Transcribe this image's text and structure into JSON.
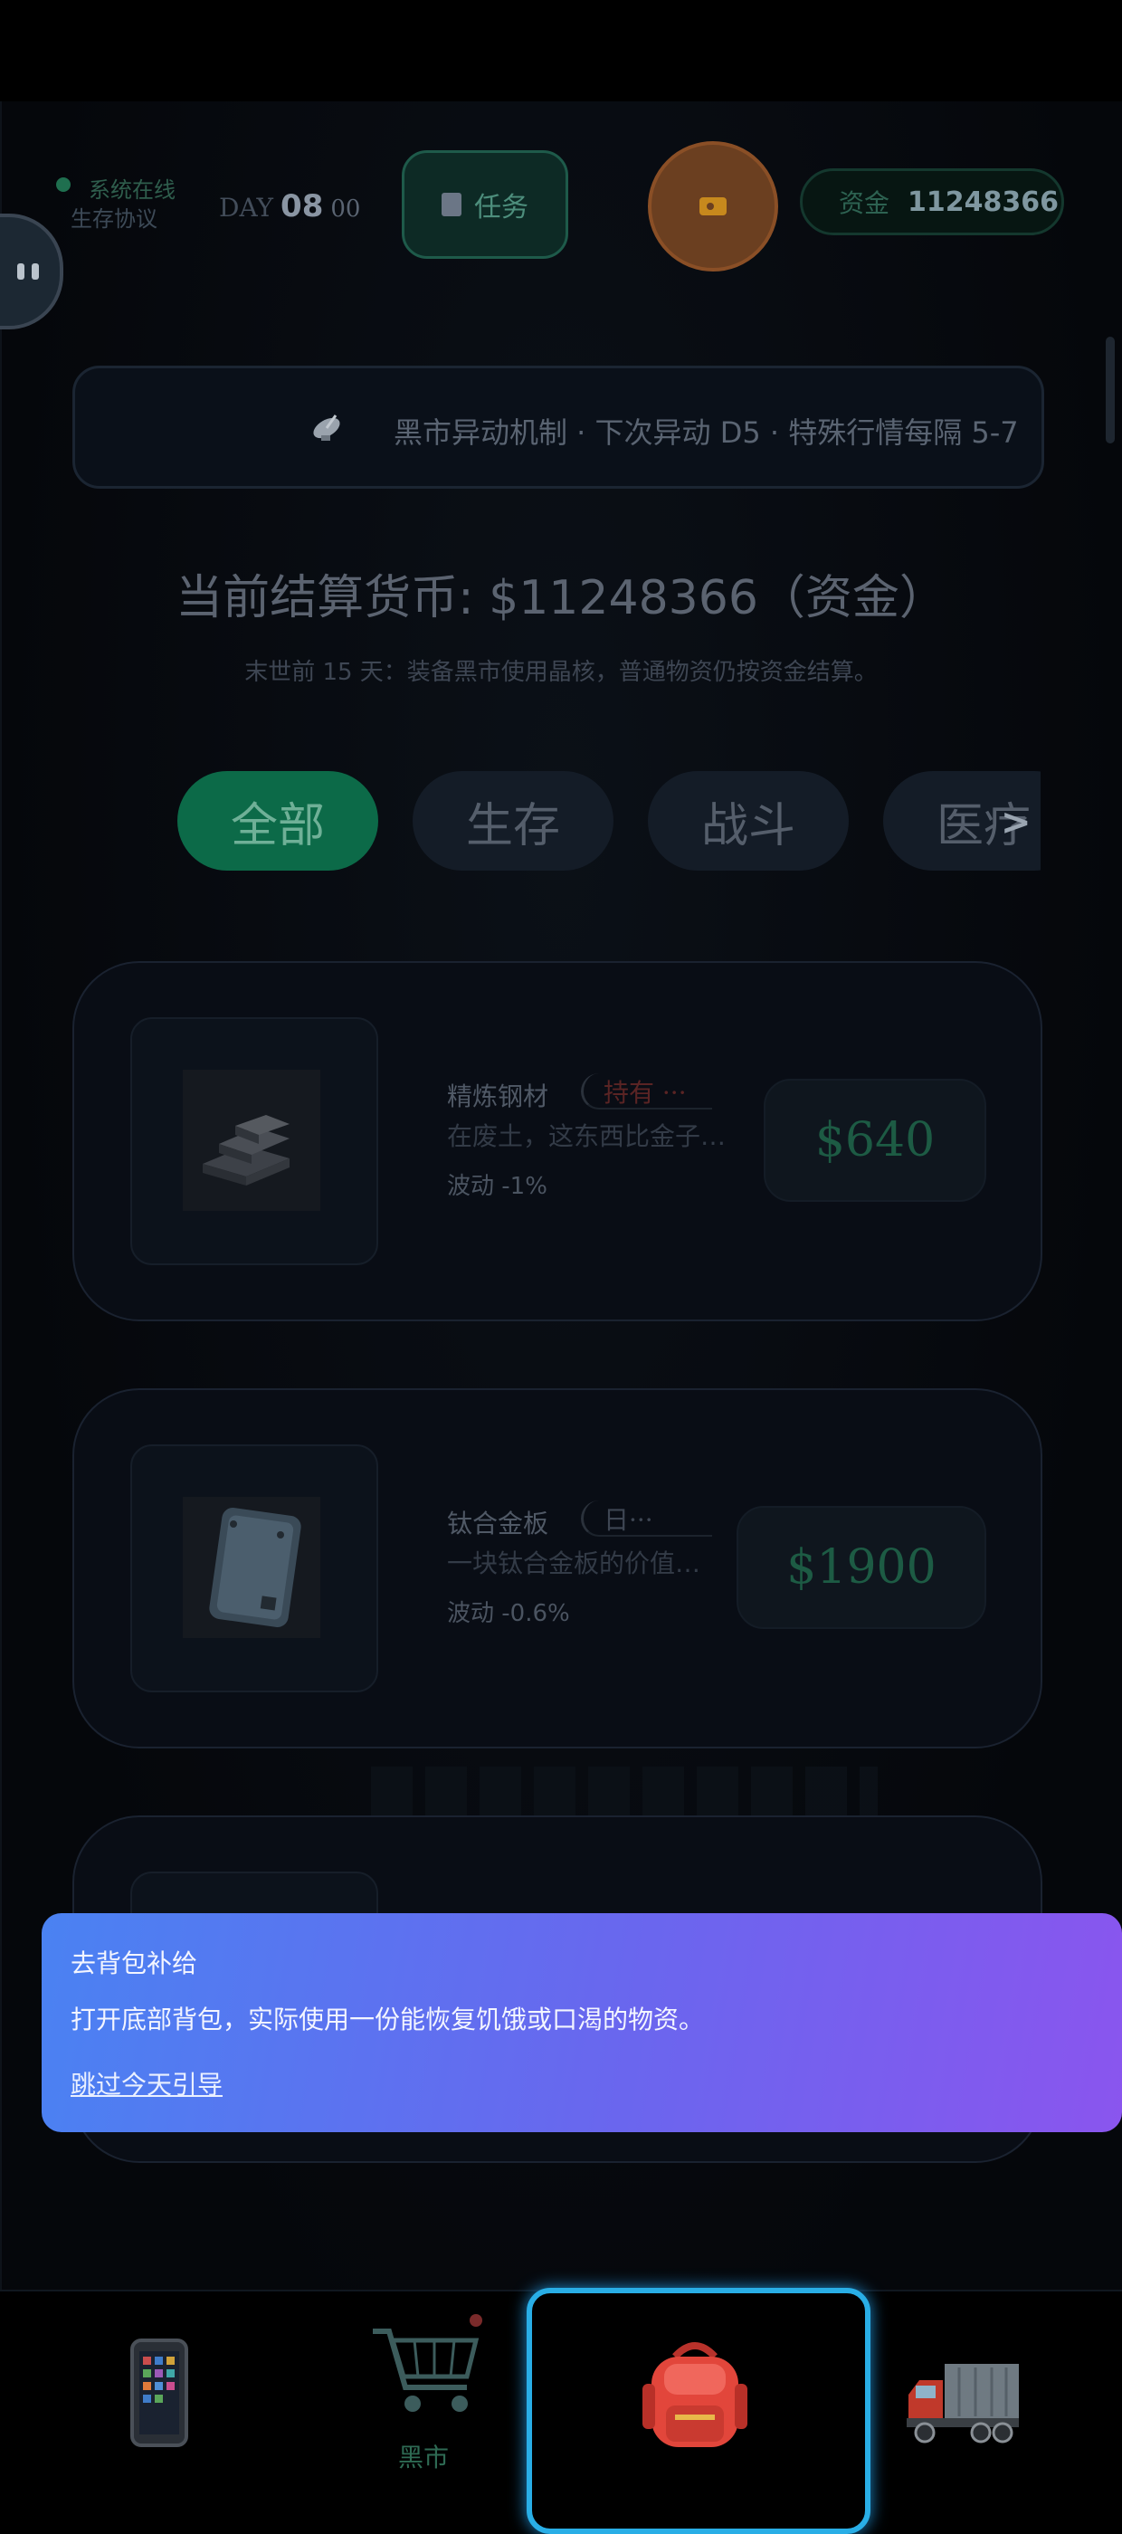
{
  "header": {
    "system_status": "系统在线",
    "protocol": "生存协议",
    "day_label": "DAY",
    "day_value": "08",
    "day_hour": "00",
    "task_label": "任务",
    "funds_label": "资金",
    "funds_value": "11248366"
  },
  "ticker": {
    "text": "黑市异动机制 · 下次异动 D5 · 特殊行情每隔 5-7"
  },
  "market": {
    "currency_line": "当前结算货币: $11248366（资金）",
    "notice": "末世前 15 天：装备黑市使用晶核，普通物资仍按资金结算。",
    "categories": [
      "全部",
      "生存",
      "战斗",
      "医疗"
    ],
    "more": ">"
  },
  "products": [
    {
      "name": "精炼钢材",
      "tag": "持有 ···",
      "desc": "在废土，这东西比金子…",
      "volatility": "波动 -1%",
      "price": "$640"
    },
    {
      "name": "钛合金板",
      "tag": "日···",
      "desc": "一块钛合金板的价值…",
      "volatility": "波动 -0.6%",
      "price": "$1900"
    }
  ],
  "tooltip": {
    "title": "去背包补给",
    "body": "打开底部背包，实际使用一份能恢复饥饿或口渴的物资。",
    "skip": "跳过今天引导"
  },
  "nav": {
    "market_label": "黑市"
  },
  "colors": {
    "accent_green": "#0c6a48",
    "tip_gradient_start": "#4a82f2",
    "tip_gradient_end": "#8a55ee",
    "nav_highlight": "#29aee6"
  },
  "icons": [
    "pause-icon",
    "clipboard-icon",
    "radio-icon",
    "satellite-icon",
    "steel-ingot-icon",
    "titanium-plate-icon",
    "phone-icon",
    "cart-icon",
    "backpack-icon",
    "truck-icon"
  ]
}
